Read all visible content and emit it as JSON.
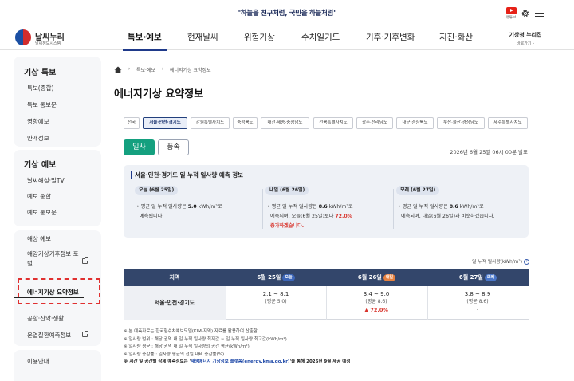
{
  "top": {
    "slogan": "\"하늘을 친구처럼, 국민을 하늘처럼\"",
    "youtube_label": "유튜브"
  },
  "logo": {
    "title": "날씨누리",
    "subtitle": "날씨정보시스템"
  },
  "nav": {
    "items": [
      "특보·예보",
      "현재날씨",
      "위험기상",
      "수치일기도",
      "기후·기후변화",
      "지진·화산"
    ],
    "portal_title": "기상청 누리집",
    "portal_sub": "바로가기 ›"
  },
  "sidebar": {
    "groups": [
      {
        "title": "기상 특보",
        "items": [
          "특보(종합)",
          "특보 통보문",
          "영향예보",
          "안개정보"
        ]
      },
      {
        "title": "기상 예보",
        "items": [
          "날씨해설·멀TV",
          "예보 종합",
          "예보 통보문"
        ]
      },
      {
        "title": "",
        "items": [
          "해상 예보",
          "해양기상기후정보 포털",
          "에너지기상 요약정보",
          "공항·산악·생활",
          "온열질환예측정보"
        ]
      },
      {
        "title": "",
        "items": [
          "이용안내"
        ]
      }
    ]
  },
  "breadcrumb": {
    "items": [
      "특보·예보",
      "에너지기상 요약정보"
    ]
  },
  "page": {
    "title": "에너지기상 요약정보"
  },
  "regions": {
    "items": [
      "전국",
      "서울·인천·경기도",
      "강원특별자치도",
      "충청북도",
      "대전·세종·충청남도",
      "전북특별자치도",
      "광주·전라남도",
      "대구·경상북도",
      "부산·울산·경상남도",
      "제주특별자치도"
    ],
    "selected": "서울·인천·경기도"
  },
  "tabs": {
    "sun": "일사",
    "wind": "풍속",
    "selected": "일사"
  },
  "issued": "2026년 6월 25일 06시 00분 발표",
  "forecast": {
    "title": "서울·인천·경기도 일 누적 일사량 예측 정보",
    "days": [
      {
        "badge": "오늘 (6월 25일)",
        "pre": "평균 일 누적 일사량은 ",
        "value": "5.0",
        "unit": " kWh/m²로",
        "line2": "예측됩니다.",
        "change": "",
        "post": ""
      },
      {
        "badge": "내일 (6월 26일)",
        "pre": "평균 일 누적 일사량은 ",
        "value": "8.6",
        "unit": " kWh/m²로",
        "line2": "예측되며, 오늘(6월 25일)보다 ",
        "change": "72.0%",
        "post": "증가하겠습니다."
      },
      {
        "badge": "모레 (6월 27일)",
        "pre": "평균 일 누적 일사량은 ",
        "value": "8.6",
        "unit": " kWh/m²로",
        "line2": "예측되며, 내일(6월 26일)과 비슷하겠습니다.",
        "change": "",
        "post": ""
      }
    ]
  },
  "table": {
    "unit_label": "일 누적 일사량(kWh/m²)",
    "help_icon": "?",
    "headers": [
      {
        "label": "지역",
        "pill": ""
      },
      {
        "label": "6월 25일",
        "pill": "오늘"
      },
      {
        "label": "6월 26일",
        "pill": "내일"
      },
      {
        "label": "6월 27일",
        "pill": "모레"
      }
    ],
    "row": {
      "region": "서울·인천·경기도",
      "cells": [
        {
          "range": "2.1 ~ 8.1",
          "avg": "(평균 5.0)",
          "change": ""
        },
        {
          "range": "3.4 ~ 9.0",
          "avg": "(평균 8.6)",
          "change": "▲ 72.0%"
        },
        {
          "range": "3.8 ~ 8.9",
          "avg": "(평균 8.6)",
          "change": "-"
        }
      ]
    }
  },
  "notes": [
    "※ 본 예측자료는 한국형수치예보모델(KIM-지역) 자료를 활용하여 산출함",
    "※ 일사량 범위 : 해당 권역 내 일 누적 일사량 최저값 ~ 일 누적 일사량 최고값(kWh/m²)",
    "※ 일사량 평균 : 해당 권역 내 일 누적 일사량의 공간 평균(kWh/m²)",
    "※ 일사량 증감률 : 일사량 평균의 전일 대비 증감률(%)"
  ],
  "note_last": {
    "pre": "※ 시간 및 공간별 상세 예측정보는 '",
    "link": "재생에너지 기상정보 플랫폼(energy.kma.go.kr)",
    "post": "'을 통해 2026년 9월 제공 예정"
  },
  "colors": {
    "accent_navy": "#1f3a8a",
    "tab_green": "#14a07f",
    "increase_red": "#d8332b",
    "table_head": "#33466b"
  }
}
